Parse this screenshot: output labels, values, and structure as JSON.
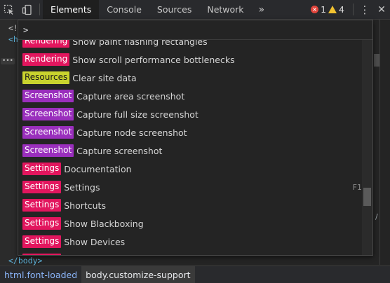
{
  "toolbar": {
    "tabs": [
      "Elements",
      "Console",
      "Sources",
      "Network"
    ],
    "more_tabs": "»",
    "error_count": "1",
    "warning_count": "4",
    "error_glyph": "×",
    "kebab_glyph": "⋮",
    "close_glyph": "✕"
  },
  "background": {
    "frag1": "<!",
    "frag2": "<h",
    "ellipsis": "•••",
    "body_close": "</body>",
    "right_frag": "/"
  },
  "command_menu": {
    "prompt": ">",
    "input_value": "",
    "items": [
      {
        "category": "Rendering",
        "label": "Show paint flashing rectangles",
        "type": "rendering",
        "shortcut": ""
      },
      {
        "category": "Rendering",
        "label": "Show scroll performance bottlenecks",
        "type": "rendering",
        "shortcut": ""
      },
      {
        "category": "Resources",
        "label": "Clear site data",
        "type": "resources",
        "shortcut": ""
      },
      {
        "category": "Screenshot",
        "label": "Capture area screenshot",
        "type": "screenshot",
        "shortcut": ""
      },
      {
        "category": "Screenshot",
        "label": "Capture full size screenshot",
        "type": "screenshot",
        "shortcut": ""
      },
      {
        "category": "Screenshot",
        "label": "Capture node screenshot",
        "type": "screenshot",
        "shortcut": ""
      },
      {
        "category": "Screenshot",
        "label": "Capture screenshot",
        "type": "screenshot",
        "shortcut": ""
      },
      {
        "category": "Settings",
        "label": "Documentation",
        "type": "settings",
        "shortcut": ""
      },
      {
        "category": "Settings",
        "label": "Settings",
        "type": "settings",
        "shortcut": "F1"
      },
      {
        "category": "Settings",
        "label": "Shortcuts",
        "type": "settings",
        "shortcut": ""
      },
      {
        "category": "Settings",
        "label": "Show Blackboxing",
        "type": "settings",
        "shortcut": ""
      },
      {
        "category": "Settings",
        "label": "Show Devices",
        "type": "settings",
        "shortcut": ""
      },
      {
        "category": "Settings",
        "label": "",
        "type": "settings",
        "shortcut": ""
      }
    ]
  },
  "breadcrumbs": [
    "html.font-loaded",
    "body.customize-support"
  ],
  "colors": {
    "rendering": "#e2165e",
    "settings": "#e2165e",
    "resources": "#c9d32e",
    "screenshot": "#9a2fbd",
    "error": "#e2453c",
    "warning": "#f2c230"
  }
}
